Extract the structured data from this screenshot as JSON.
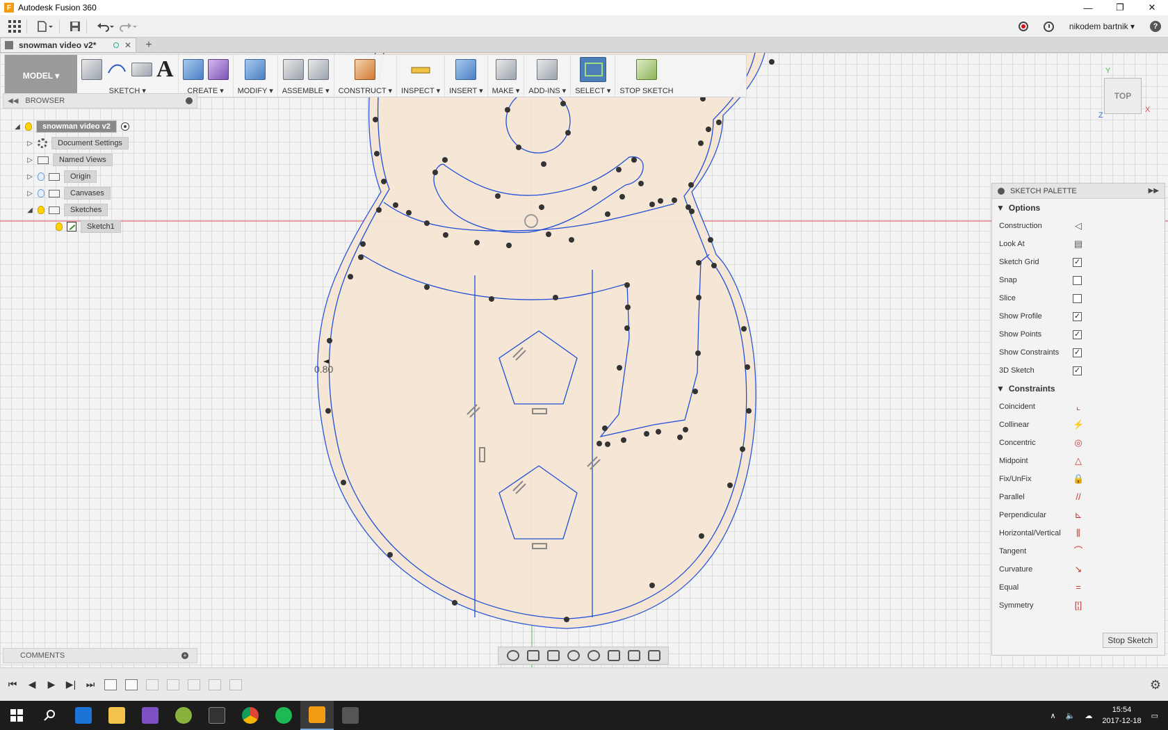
{
  "window": {
    "title": "Autodesk Fusion 360",
    "app_icon": "F",
    "controls": [
      "—",
      "❐",
      "✕"
    ]
  },
  "quick_access": {
    "user": "nikodem bartnik ▾",
    "help": "?"
  },
  "tabs": {
    "active": "snowman video v2*",
    "close": "✕",
    "new": "+"
  },
  "ribbon": {
    "mode": "MODEL ▾",
    "groups": [
      "SKETCH ▾",
      "CREATE ▾",
      "MODIFY ▾",
      "ASSEMBLE ▾",
      "CONSTRUCT ▾",
      "INSPECT ▾",
      "INSERT ▾",
      "MAKE ▾",
      "ADD-INS ▾",
      "SELECT ▾",
      "STOP SKETCH"
    ],
    "text_tool": "A"
  },
  "browser": {
    "title": "BROWSER",
    "root": "snowman video v2",
    "items": [
      "Document Settings",
      "Named Views",
      "Origin",
      "Canvases",
      "Sketches",
      "Sketch1"
    ]
  },
  "comments": {
    "title": "COMMENTS"
  },
  "viewcube": {
    "face": "TOP",
    "axis_x": "X",
    "axis_y": "Y",
    "axis_z": "Z"
  },
  "dimension": "0.80",
  "palette": {
    "title": "SKETCH PALETTE",
    "options_header": "Options",
    "options": [
      {
        "label": "Construction",
        "control": "icon",
        "icon": "construction-icon",
        "glyph": "◁"
      },
      {
        "label": "Look At",
        "control": "icon",
        "icon": "look-at-icon",
        "glyph": "▤"
      },
      {
        "label": "Sketch Grid",
        "control": "checkbox",
        "checked": "✓"
      },
      {
        "label": "Snap",
        "control": "checkbox",
        "checked": ""
      },
      {
        "label": "Slice",
        "control": "checkbox",
        "checked": ""
      },
      {
        "label": "Show Profile",
        "control": "checkbox",
        "checked": "✓"
      },
      {
        "label": "Show Points",
        "control": "checkbox",
        "checked": "✓"
      },
      {
        "label": "Show Constraints",
        "control": "checkbox",
        "checked": "✓"
      },
      {
        "label": "3D Sketch",
        "control": "checkbox",
        "checked": "✓"
      }
    ],
    "constraints_header": "Constraints",
    "constraints": [
      {
        "label": "Coincident",
        "icon": "coincident-icon",
        "glyph": "⌞"
      },
      {
        "label": "Collinear",
        "icon": "collinear-icon",
        "glyph": "⚡"
      },
      {
        "label": "Concentric",
        "icon": "concentric-icon",
        "glyph": "◎"
      },
      {
        "label": "Midpoint",
        "icon": "midpoint-icon",
        "glyph": "△"
      },
      {
        "label": "Fix/UnFix",
        "icon": "fix-icon",
        "glyph": "🔒"
      },
      {
        "label": "Parallel",
        "icon": "parallel-icon",
        "glyph": "//"
      },
      {
        "label": "Perpendicular",
        "icon": "perpendicular-icon",
        "glyph": "⊾"
      },
      {
        "label": "Horizontal/Vertical",
        "icon": "horizontal-vertical-icon",
        "glyph": "⫼"
      },
      {
        "label": "Tangent",
        "icon": "tangent-icon",
        "glyph": "⌒"
      },
      {
        "label": "Curvature",
        "icon": "curvature-icon",
        "glyph": "↘"
      },
      {
        "label": "Equal",
        "icon": "equal-icon",
        "glyph": "="
      },
      {
        "label": "Symmetry",
        "icon": "symmetry-icon",
        "glyph": "[¦]"
      }
    ],
    "stop_button": "Stop Sketch"
  },
  "taskbar": {
    "time": "15:54",
    "date": "2017-12-18"
  },
  "colors": {
    "sketch_line": "#1f4fd6",
    "profile_fill": "#f6e6d4",
    "red_axis": "#e05050",
    "green_axis": "#4cc04c"
  }
}
